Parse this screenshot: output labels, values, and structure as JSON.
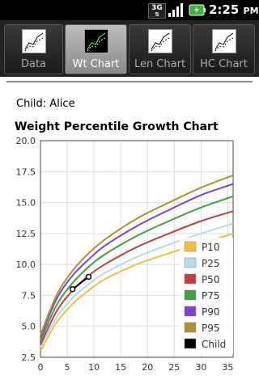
{
  "status_bar": {
    "network": "3G",
    "time": "2:25",
    "time_suffix": "PM"
  },
  "tabs": [
    {
      "label": "Data",
      "active": false
    },
    {
      "label": "Wt Chart",
      "active": true
    },
    {
      "label": "Len Chart",
      "active": false
    },
    {
      "label": "HC Chart",
      "active": false
    }
  ],
  "child": {
    "label": "Child: Alice"
  },
  "chart_data": {
    "type": "line",
    "title": "Weight Percentile Growth Chart",
    "xlim": [
      0,
      36
    ],
    "ylim": [
      2.5,
      20.0
    ],
    "x_ticks": [
      0,
      5,
      10,
      15,
      20,
      25,
      30,
      35
    ],
    "y_ticks": [
      "2.5",
      "5.0",
      "7.5",
      "10.0",
      "12.5",
      "15.0",
      "17.5",
      "20.0"
    ],
    "grid": true,
    "legend_position": "bottom-right",
    "x": [
      0,
      3,
      6,
      9,
      12,
      18,
      24,
      30,
      36
    ],
    "series": [
      {
        "name": "P10",
        "color": "#f0c040",
        "values": [
          3.0,
          5.3,
          6.8,
          7.9,
          8.8,
          10.0,
          10.9,
          11.7,
          12.5
        ]
      },
      {
        "name": "P25",
        "color": "#b8d8f0",
        "values": [
          3.3,
          5.7,
          7.3,
          8.4,
          9.3,
          10.6,
          11.6,
          12.5,
          13.3
        ]
      },
      {
        "name": "P50",
        "color": "#c04040",
        "values": [
          3.5,
          6.2,
          7.9,
          9.1,
          10.0,
          11.4,
          12.5,
          13.5,
          14.3
        ]
      },
      {
        "name": "P75",
        "color": "#40a040",
        "values": [
          3.8,
          6.7,
          8.5,
          9.8,
          10.8,
          12.3,
          13.5,
          14.6,
          15.5
        ]
      },
      {
        "name": "P90",
        "color": "#8040d0",
        "values": [
          4.1,
          7.2,
          9.1,
          10.4,
          11.5,
          13.1,
          14.4,
          15.6,
          16.5
        ]
      },
      {
        "name": "P95",
        "color": "#b09030",
        "values": [
          4.3,
          7.5,
          9.5,
          10.9,
          12.0,
          13.7,
          15.0,
          16.2,
          17.2
        ]
      }
    ],
    "child_series": {
      "name": "Child",
      "color": "#000000",
      "x": [
        6,
        9
      ],
      "values": [
        8.0,
        9.0
      ]
    }
  }
}
